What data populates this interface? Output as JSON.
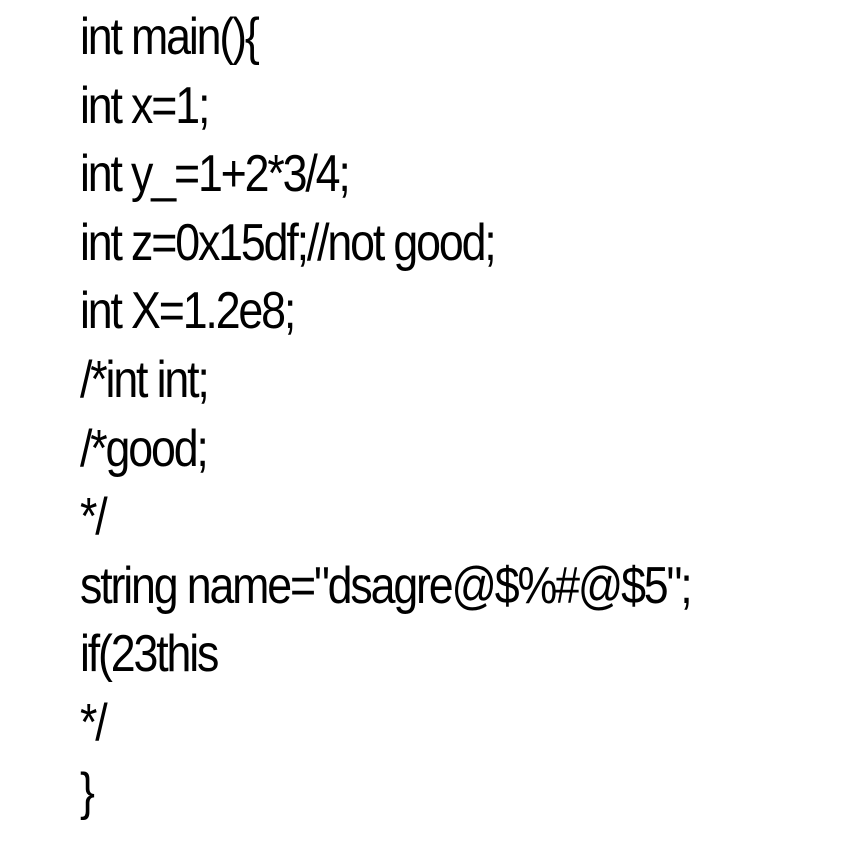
{
  "code": {
    "lines": [
      "int main(){",
      "int x=1;",
      "int y_=1+2*3/4;",
      "int z=0x15df;//not good;",
      "int X=1.2e8;",
      "/*int int;",
      "/*good;",
      "*/",
      "string name=\"dsagre@$%#@$5\";",
      "if(23this",
      "*/",
      "}"
    ]
  }
}
